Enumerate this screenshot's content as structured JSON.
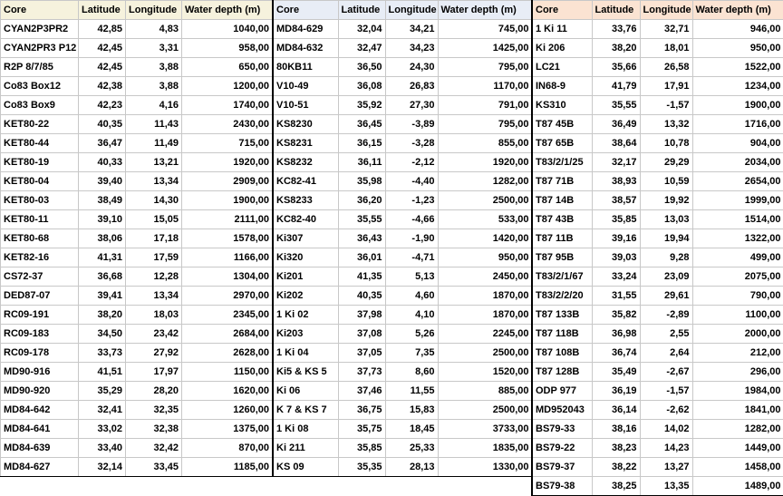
{
  "headers": [
    "Core",
    "Latitude",
    "Longitude",
    "Water depth (m)"
  ],
  "colors": {
    "block1_header": "#f6f2dd",
    "block2_header": "#e8edf6",
    "block3_header": "#fbe3d2"
  },
  "blocks": [
    {
      "rows": [
        [
          "CYAN2P3PR2",
          "42,85",
          "4,83",
          "1040,00"
        ],
        [
          "CYAN2PR3 P12",
          "42,45",
          "3,31",
          "958,00"
        ],
        [
          "R2P 8/7/85",
          "42,45",
          "3,88",
          "650,00"
        ],
        [
          "Co83 Box12",
          "42,38",
          "3,88",
          "1200,00"
        ],
        [
          "Co83 Box9",
          "42,23",
          "4,16",
          "1740,00"
        ],
        [
          "KET80-22",
          "40,35",
          "11,43",
          "2430,00"
        ],
        [
          "KET80-44",
          "36,47",
          "11,49",
          "715,00"
        ],
        [
          "KET80-19",
          "40,33",
          "13,21",
          "1920,00"
        ],
        [
          "KET80-04",
          "39,40",
          "13,34",
          "2909,00"
        ],
        [
          "KET80-03",
          "38,49",
          "14,30",
          "1900,00"
        ],
        [
          "KET80-11",
          "39,10",
          "15,05",
          "2111,00"
        ],
        [
          "KET80-68",
          "38,06",
          "17,18",
          "1578,00"
        ],
        [
          "KET82-16",
          "41,31",
          "17,59",
          "1166,00"
        ],
        [
          "CS72-37",
          "36,68",
          "12,28",
          "1304,00"
        ],
        [
          "DED87-07",
          "39,41",
          "13,34",
          "2970,00"
        ],
        [
          "RC09-191",
          "38,20",
          "18,03",
          "2345,00"
        ],
        [
          "RC09-183",
          "34,50",
          "23,42",
          "2684,00"
        ],
        [
          "RC09-178",
          "33,73",
          "27,92",
          "2628,00"
        ],
        [
          "MD90-916",
          "41,51",
          "17,97",
          "1150,00"
        ],
        [
          "MD90-920",
          "35,29",
          "28,20",
          "1620,00"
        ],
        [
          "MD84-642",
          "32,41",
          "32,35",
          "1260,00"
        ],
        [
          "MD84-641",
          "33,02",
          "32,38",
          "1375,00"
        ],
        [
          "MD84-639",
          "33,40",
          "32,42",
          "870,00"
        ],
        [
          "MD84-627",
          "32,14",
          "33,45",
          "1185,00"
        ]
      ]
    },
    {
      "rows": [
        [
          "MD84-629",
          "32,04",
          "34,21",
          "745,00"
        ],
        [
          "MD84-632",
          "32,47",
          "34,23",
          "1425,00"
        ],
        [
          "80KB11",
          "36,50",
          "24,30",
          "795,00"
        ],
        [
          "V10-49",
          "36,08",
          "26,83",
          "1170,00"
        ],
        [
          "V10-51",
          "35,92",
          "27,30",
          "791,00"
        ],
        [
          "KS8230",
          "36,45",
          "-3,89",
          "795,00"
        ],
        [
          "KS8231",
          "36,15",
          "-3,28",
          "855,00"
        ],
        [
          "KS8232",
          "36,11",
          "-2,12",
          "1920,00"
        ],
        [
          "KC82-41",
          "35,98",
          "-4,40",
          "1282,00"
        ],
        [
          "KS8233",
          "36,20",
          "-1,23",
          "2500,00"
        ],
        [
          "KC82-40",
          "35,55",
          "-4,66",
          "533,00"
        ],
        [
          "Ki307",
          "36,43",
          "-1,90",
          "1420,00"
        ],
        [
          "Ki320",
          "36,01",
          "-4,71",
          "950,00"
        ],
        [
          "Ki201",
          "41,35",
          "5,13",
          "2450,00"
        ],
        [
          "Ki202",
          "40,35",
          "4,60",
          "1870,00"
        ],
        [
          "1 Ki 02",
          "37,98",
          "4,10",
          "1870,00"
        ],
        [
          "Ki203",
          "37,08",
          "5,26",
          "2245,00"
        ],
        [
          "1 Ki 04",
          "37,05",
          "7,35",
          "2500,00"
        ],
        [
          "Ki5 & KS 5",
          "37,73",
          "8,60",
          "1520,00"
        ],
        [
          "Ki 06",
          "37,46",
          "11,55",
          "885,00"
        ],
        [
          "K 7 & KS 7",
          "36,75",
          "15,83",
          "2500,00"
        ],
        [
          "1 Ki 08",
          "35,75",
          "18,45",
          "3733,00"
        ],
        [
          "Ki 211",
          "35,85",
          "25,33",
          "1835,00"
        ],
        [
          "KS 09",
          "35,35",
          "28,13",
          "1330,00"
        ]
      ]
    },
    {
      "rows": [
        [
          "1 Ki 11",
          "33,76",
          "32,71",
          "946,00"
        ],
        [
          "Ki 206",
          "38,20",
          "18,01",
          "950,00"
        ],
        [
          "LC21",
          "35,66",
          "26,58",
          "1522,00"
        ],
        [
          "IN68-9",
          "41,79",
          "17,91",
          "1234,00"
        ],
        [
          "KS310",
          "35,55",
          "-1,57",
          "1900,00"
        ],
        [
          "T87 45B",
          "36,49",
          "13,32",
          "1716,00"
        ],
        [
          "T87 65B",
          "38,64",
          "10,78",
          "904,00"
        ],
        [
          "T83/2/1/25",
          "32,17",
          "29,29",
          "2034,00"
        ],
        [
          "T87 71B",
          "38,93",
          "10,59",
          "2654,00"
        ],
        [
          "T87 14B",
          "38,57",
          "19,92",
          "1999,00"
        ],
        [
          "T87 43B",
          "35,85",
          "13,03",
          "1514,00"
        ],
        [
          "T87 11B",
          "39,16",
          "19,94",
          "1322,00"
        ],
        [
          "T87 95B",
          "39,03",
          "9,28",
          "499,00"
        ],
        [
          "T83/2/1/67",
          "33,24",
          "23,09",
          "2075,00"
        ],
        [
          "T83/2/2/20",
          "31,55",
          "29,61",
          "790,00"
        ],
        [
          "T87 133B",
          "35,82",
          "-2,89",
          "1100,00"
        ],
        [
          "T87 118B",
          "36,98",
          "2,55",
          "2000,00"
        ],
        [
          "T87 108B",
          "36,74",
          "2,64",
          "212,00"
        ],
        [
          "T87 128B",
          "35,49",
          "-2,67",
          "296,00"
        ],
        [
          "ODP 977",
          "36,19",
          "-1,57",
          "1984,00"
        ],
        [
          "MD952043",
          "36,14",
          "-2,62",
          "1841,00"
        ],
        [
          "BS79-33",
          "38,16",
          "14,02",
          "1282,00"
        ],
        [
          "BS79-22",
          "38,23",
          "14,23",
          "1449,00"
        ],
        [
          "BS79-37",
          "38,22",
          "13,27",
          "1458,00"
        ],
        [
          "BS79-38",
          "38,25",
          "13,35",
          "1489,00"
        ]
      ]
    }
  ]
}
